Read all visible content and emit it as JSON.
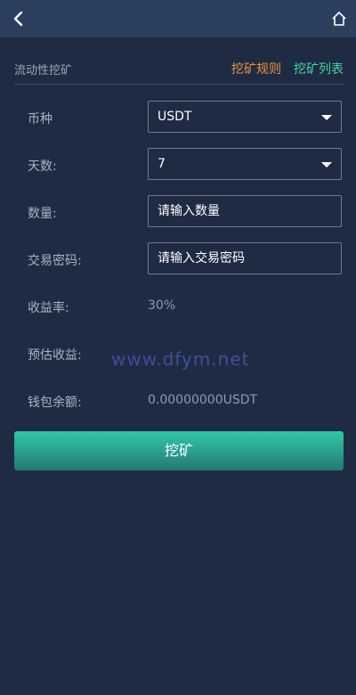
{
  "header": {
    "back_icon": "chevron-left-icon",
    "home_icon": "home-icon"
  },
  "subheader": {
    "title": "流动性挖矿",
    "rules_link": "挖矿规则",
    "list_link": "挖矿列表"
  },
  "form": {
    "currency": {
      "label": "币种",
      "selected": "USDT"
    },
    "days": {
      "label": "天数:",
      "selected": "7"
    },
    "amount": {
      "label": "数量:",
      "placeholder": "请输入数量"
    },
    "password": {
      "label": "交易密码:",
      "placeholder": "请输入交易密码"
    },
    "yield_rate": {
      "label": "收益率:",
      "value": "30%"
    },
    "estimated_income": {
      "label": "预估收益:",
      "value": ""
    },
    "wallet_balance": {
      "label": "钱包余额:",
      "value": "0.00000000USDT"
    }
  },
  "watermark": "www.dfym.net",
  "submit_button": "挖矿",
  "colors": {
    "background": "#1e2b43",
    "topbar": "#2b3e5e",
    "rules_link": "#e8953a",
    "list_link": "#49d4a4",
    "button_gradient_top": "#2fc9a4",
    "button_gradient_bottom": "#24786f"
  }
}
